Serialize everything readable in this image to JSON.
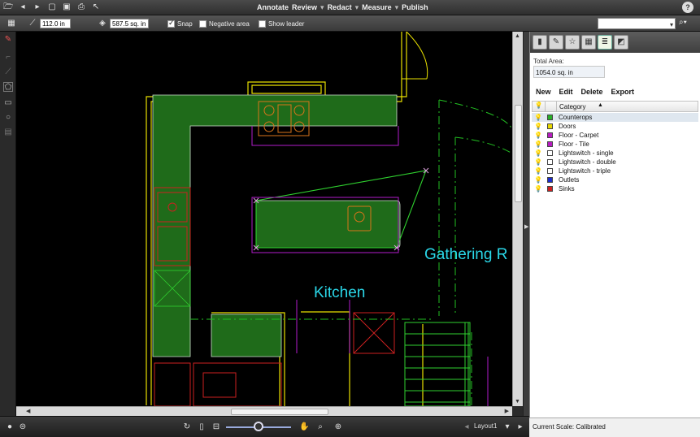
{
  "menu": {
    "items": [
      "Annotate",
      "Review",
      "Redact",
      "Measure",
      "Publish"
    ],
    "separator": "▾"
  },
  "properties": {
    "length_value": "112.0 in",
    "area_value": "587.5 sq. in",
    "snap_label": "Snap",
    "snap_checked": true,
    "negative_area_label": "Negative area",
    "show_leader_label": "Show leader"
  },
  "canvas": {
    "room_labels": [
      "Kitchen",
      "Gathering R"
    ],
    "colors": {
      "background": "#000000",
      "walls": "#e8e000",
      "counter_fill": "#1f6b1a",
      "label": "#2ad7e8",
      "measure_line": "#2fd12f",
      "sinks": "#cc2020",
      "outlines": "#b21ccc"
    }
  },
  "panel": {
    "total_area_label": "Total Area:",
    "total_area_value": "1054.0 sq. in",
    "actions": [
      "New",
      "Edit",
      "Delete",
      "Export"
    ],
    "column_header": "Category",
    "categories": [
      {
        "name": "Counterops",
        "color": "#27b027",
        "selected": true
      },
      {
        "name": "Doors",
        "color": "#e8d800",
        "selected": false
      },
      {
        "name": "Floor - Carpet",
        "color": "#b81cc0",
        "selected": false
      },
      {
        "name": "Floor - Tile",
        "color": "#b81cc0",
        "selected": false
      },
      {
        "name": "Lightswitch - single",
        "color": "#ffffff",
        "selected": false
      },
      {
        "name": "Lightswitch - double",
        "color": "#ffffff",
        "selected": false
      },
      {
        "name": "Lightswitch - triple",
        "color": "#ffffff",
        "selected": false
      },
      {
        "name": "Outlets",
        "color": "#1c2ccc",
        "selected": false
      },
      {
        "name": "Sinks",
        "color": "#cc2020",
        "selected": false
      }
    ]
  },
  "status": {
    "scale_label": "Current Scale:",
    "scale_value": "Calibrated"
  },
  "bottom": {
    "page_label": "Layout1"
  }
}
